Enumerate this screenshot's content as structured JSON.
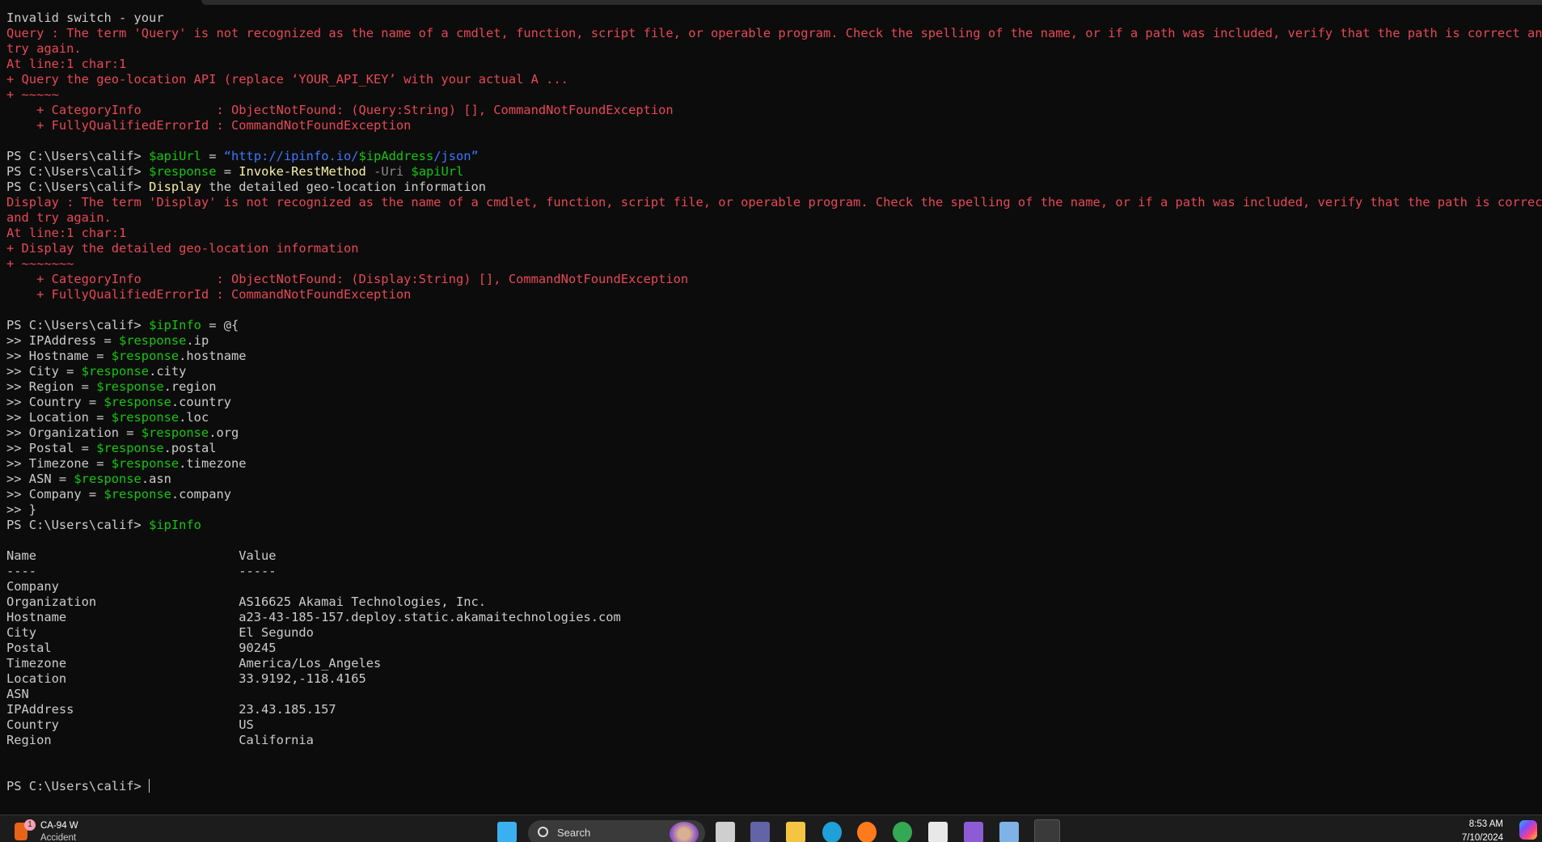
{
  "terminal": {
    "lines": [
      [
        {
          "t": "Invalid switch - your",
          "c": "w"
        }
      ],
      [
        {
          "t": "Query : The term 'Query' is not recognized as the name of a cmdlet, function, script file, or operable program. Check the spelling of the name, or if a path was included, verify that the path is correct and",
          "c": "r"
        }
      ],
      [
        {
          "t": "try again.",
          "c": "r"
        }
      ],
      [
        {
          "t": "At line:1 char:1",
          "c": "r"
        }
      ],
      [
        {
          "t": "+ Query the geo-location API (replace ‘YOUR_API_KEY’ with your actual A ...",
          "c": "r"
        }
      ],
      [
        {
          "t": "+ ~~~~~",
          "c": "r"
        }
      ],
      [
        {
          "t": "    + CategoryInfo          : ObjectNotFound: (Query:String) [], CommandNotFoundException",
          "c": "r"
        }
      ],
      [
        {
          "t": "    + FullyQualifiedErrorId : CommandNotFoundException",
          "c": "r"
        }
      ],
      [],
      [
        {
          "t": "PS C:\\Users\\calif> ",
          "c": "w"
        },
        {
          "t": "$apiUrl",
          "c": "g"
        },
        {
          "t": " = ",
          "c": "w"
        },
        {
          "t": "“http://ipinfo.io/",
          "c": "b"
        },
        {
          "t": "$ipAddress",
          "c": "g"
        },
        {
          "t": "/json”",
          "c": "b"
        }
      ],
      [
        {
          "t": "PS C:\\Users\\calif> ",
          "c": "w"
        },
        {
          "t": "$response",
          "c": "g"
        },
        {
          "t": " = ",
          "c": "w"
        },
        {
          "t": "Invoke-RestMethod",
          "c": "y"
        },
        {
          "t": " -Uri ",
          "c": "d"
        },
        {
          "t": "$apiUrl",
          "c": "g"
        }
      ],
      [
        {
          "t": "PS C:\\Users\\calif> ",
          "c": "w"
        },
        {
          "t": "Display",
          "c": "y"
        },
        {
          "t": " the detailed geo-location information",
          "c": "w"
        }
      ],
      [
        {
          "t": "Display : The term 'Display' is not recognized as the name of a cmdlet, function, script file, or operable program. Check the spelling of the name, or if a path was included, verify that the path is correct",
          "c": "r"
        }
      ],
      [
        {
          "t": "and try again.",
          "c": "r"
        }
      ],
      [
        {
          "t": "At line:1 char:1",
          "c": "r"
        }
      ],
      [
        {
          "t": "+ Display the detailed geo-location information",
          "c": "r"
        }
      ],
      [
        {
          "t": "+ ~~~~~~~",
          "c": "r"
        }
      ],
      [
        {
          "t": "    + CategoryInfo          : ObjectNotFound: (Display:String) [], CommandNotFoundException",
          "c": "r"
        }
      ],
      [
        {
          "t": "    + FullyQualifiedErrorId : CommandNotFoundException",
          "c": "r"
        }
      ],
      [],
      [
        {
          "t": "PS C:\\Users\\calif> ",
          "c": "w"
        },
        {
          "t": "$ipInfo",
          "c": "g"
        },
        {
          "t": " = @{",
          "c": "w"
        }
      ],
      [
        {
          "t": ">> IPAddress = ",
          "c": "w"
        },
        {
          "t": "$response",
          "c": "g"
        },
        {
          "t": ".ip",
          "c": "w"
        }
      ],
      [
        {
          "t": ">> Hostname = ",
          "c": "w"
        },
        {
          "t": "$response",
          "c": "g"
        },
        {
          "t": ".hostname",
          "c": "w"
        }
      ],
      [
        {
          "t": ">> City = ",
          "c": "w"
        },
        {
          "t": "$response",
          "c": "g"
        },
        {
          "t": ".city",
          "c": "w"
        }
      ],
      [
        {
          "t": ">> Region = ",
          "c": "w"
        },
        {
          "t": "$response",
          "c": "g"
        },
        {
          "t": ".region",
          "c": "w"
        }
      ],
      [
        {
          "t": ">> Country = ",
          "c": "w"
        },
        {
          "t": "$response",
          "c": "g"
        },
        {
          "t": ".country",
          "c": "w"
        }
      ],
      [
        {
          "t": ">> Location = ",
          "c": "w"
        },
        {
          "t": "$response",
          "c": "g"
        },
        {
          "t": ".loc",
          "c": "w"
        }
      ],
      [
        {
          "t": ">> Organization = ",
          "c": "w"
        },
        {
          "t": "$response",
          "c": "g"
        },
        {
          "t": ".org",
          "c": "w"
        }
      ],
      [
        {
          "t": ">> Postal = ",
          "c": "w"
        },
        {
          "t": "$response",
          "c": "g"
        },
        {
          "t": ".postal",
          "c": "w"
        }
      ],
      [
        {
          "t": ">> Timezone = ",
          "c": "w"
        },
        {
          "t": "$response",
          "c": "g"
        },
        {
          "t": ".timezone",
          "c": "w"
        }
      ],
      [
        {
          "t": ">> ASN = ",
          "c": "w"
        },
        {
          "t": "$response",
          "c": "g"
        },
        {
          "t": ".asn",
          "c": "w"
        }
      ],
      [
        {
          "t": ">> Company = ",
          "c": "w"
        },
        {
          "t": "$response",
          "c": "g"
        },
        {
          "t": ".company",
          "c": "w"
        }
      ],
      [
        {
          "t": ">> }",
          "c": "w"
        }
      ],
      [
        {
          "t": "PS C:\\Users\\calif> ",
          "c": "w"
        },
        {
          "t": "$ipInfo",
          "c": "g"
        }
      ],
      [],
      [
        {
          "t": "Name                           Value",
          "c": "w"
        }
      ],
      [
        {
          "t": "----                           -----",
          "c": "w"
        }
      ],
      [
        {
          "t": "Company",
          "c": "w"
        }
      ],
      [
        {
          "t": "Organization                   AS16625 Akamai Technologies, Inc.",
          "c": "w"
        }
      ],
      [
        {
          "t": "Hostname                       a23-43-185-157.deploy.static.akamaitechnologies.com",
          "c": "w"
        }
      ],
      [
        {
          "t": "City                           El Segundo",
          "c": "w"
        }
      ],
      [
        {
          "t": "Postal                         90245",
          "c": "w"
        }
      ],
      [
        {
          "t": "Timezone                       America/Los_Angeles",
          "c": "w"
        }
      ],
      [
        {
          "t": "Location                       33.9192,-118.4165",
          "c": "w"
        }
      ],
      [
        {
          "t": "ASN",
          "c": "w"
        }
      ],
      [
        {
          "t": "IPAddress                      23.43.185.157",
          "c": "w"
        }
      ],
      [
        {
          "t": "Country                        US",
          "c": "w"
        }
      ],
      [
        {
          "t": "Region                         California",
          "c": "w"
        }
      ],
      [],
      [],
      [
        {
          "t": "PS C:\\Users\\calif> ",
          "c": "w"
        }
      ]
    ]
  },
  "taskbar": {
    "weather": {
      "badge": "1",
      "title": "CA-94 W",
      "subtitle": "Accident"
    },
    "search_label": "Search",
    "apps": [
      {
        "name": "windows-start",
        "color": "#3ab0f0"
      },
      {
        "name": "task-view",
        "color": "#cfcfcf"
      },
      {
        "name": "teams",
        "color": "#6264a7"
      },
      {
        "name": "file-explorer",
        "color": "#f4c542"
      },
      {
        "name": "edge",
        "color": "#1fa0d8"
      },
      {
        "name": "firefox",
        "color": "#ff7a1a"
      },
      {
        "name": "chrome",
        "color": "#34a853"
      },
      {
        "name": "maps",
        "color": "#e8e8e8"
      },
      {
        "name": "clipchamp",
        "color": "#8e5bd6"
      },
      {
        "name": "notepad",
        "color": "#7fb2e5"
      },
      {
        "name": "terminal",
        "color": "#3a3a3a"
      }
    ],
    "time": "8:53 AM",
    "date": "7/10/2024"
  }
}
